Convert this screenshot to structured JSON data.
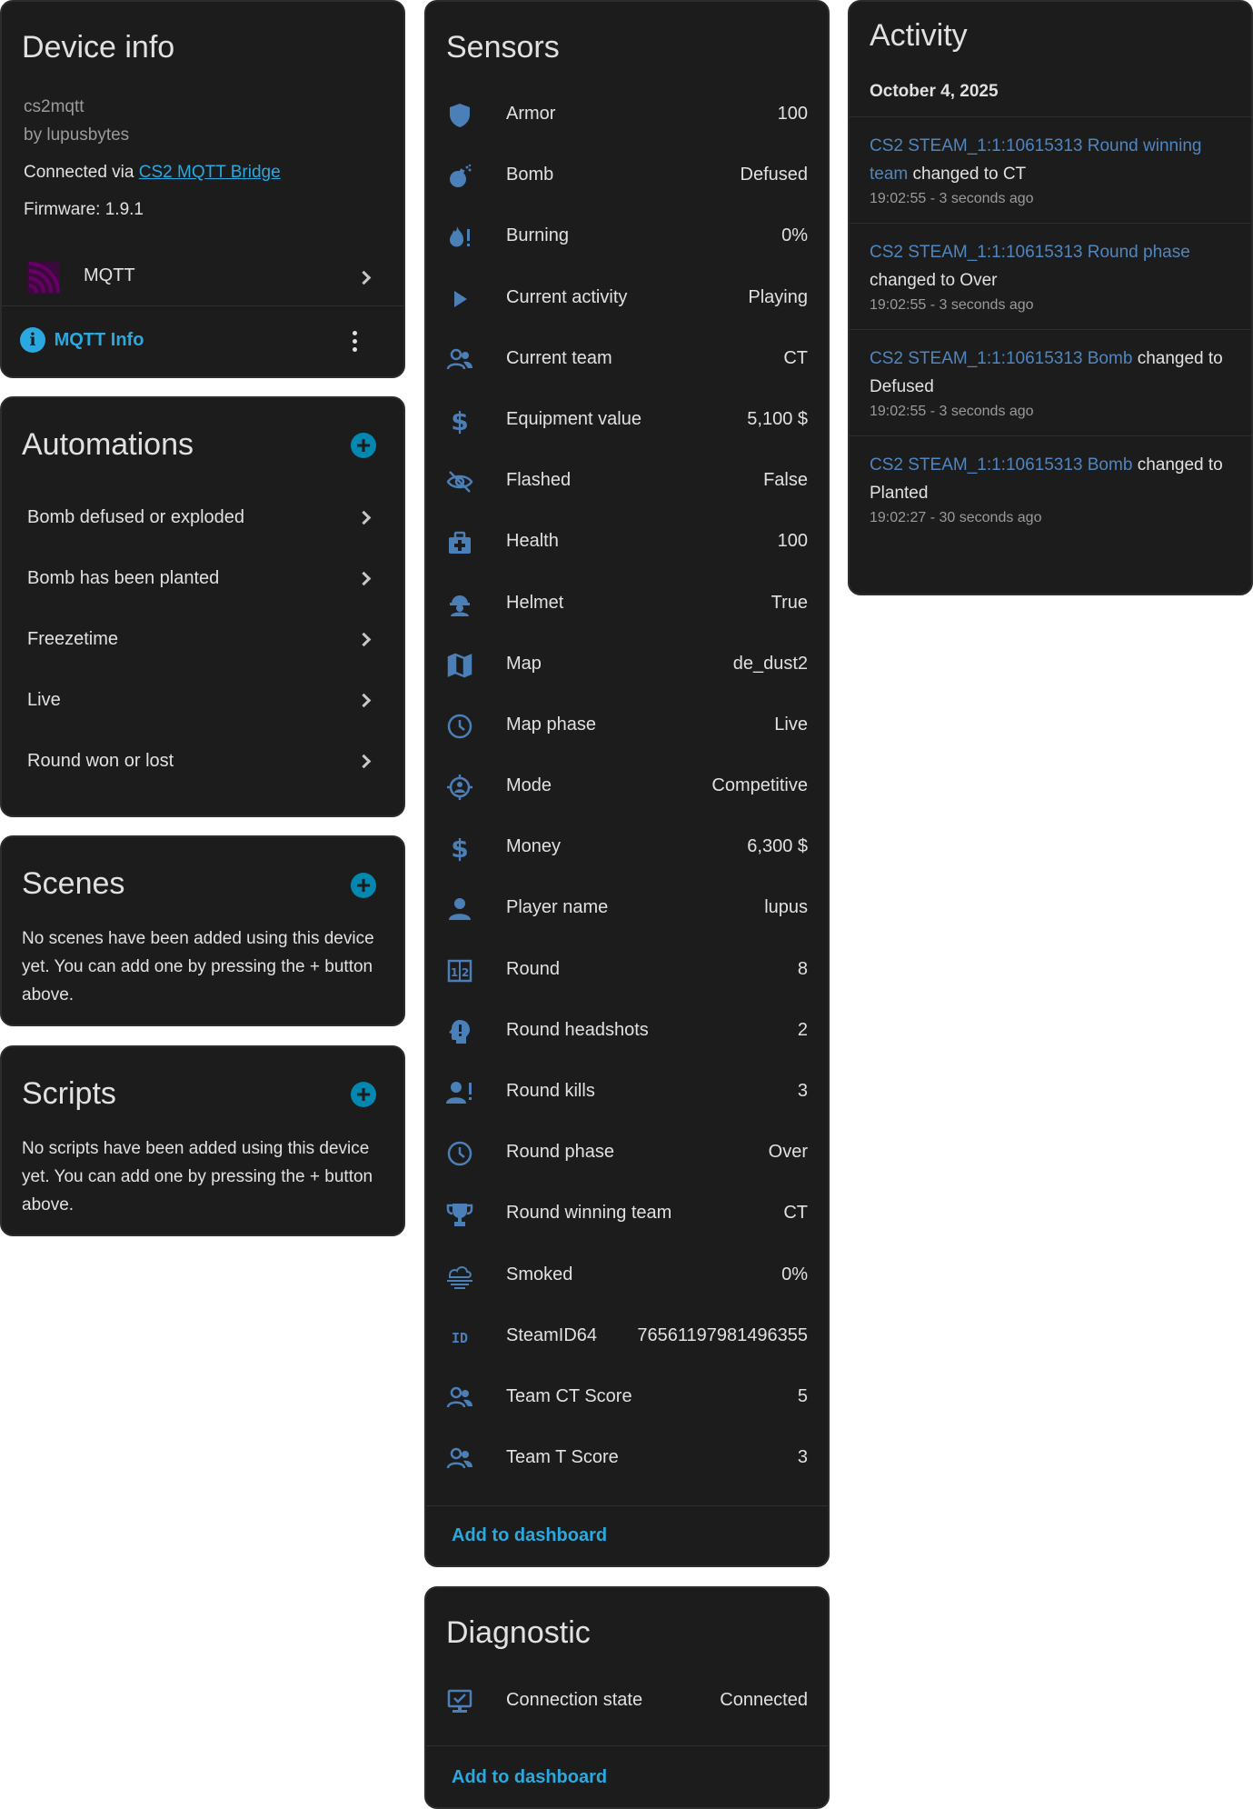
{
  "device_info": {
    "title": "Device info",
    "model": "cs2mqtt",
    "manufacturer": "by lupusbytes",
    "connected_via_prefix": "Connected via",
    "connected_via_link": "CS2 MQTT Bridge",
    "firmware": "Firmware: 1.9.1",
    "integration_label": "MQTT",
    "mqtt_info_label": "MQTT Info"
  },
  "automations": {
    "title": "Automations",
    "items": [
      {
        "label": "Bomb defused or exploded"
      },
      {
        "label": "Bomb has been planted"
      },
      {
        "label": "Freezetime"
      },
      {
        "label": "Live"
      },
      {
        "label": "Round won or lost"
      }
    ]
  },
  "scenes": {
    "title": "Scenes",
    "empty_text": "No scenes have been added using this device yet. You can add one by pressing the + button above."
  },
  "scripts": {
    "title": "Scripts",
    "empty_text": "No scripts have been added using this device yet. You can add one by pressing the + button above."
  },
  "sensors": {
    "title": "Sensors",
    "items": [
      {
        "icon": "shield-icon",
        "name": "Armor",
        "value": "100"
      },
      {
        "icon": "bomb-icon",
        "name": "Bomb",
        "value": "Defused"
      },
      {
        "icon": "fire-alert-icon",
        "name": "Burning",
        "value": "0%"
      },
      {
        "icon": "play-icon",
        "name": "Current activity",
        "value": "Playing"
      },
      {
        "icon": "account-group-icon",
        "name": "Current team",
        "value": "CT"
      },
      {
        "icon": "dollar-icon",
        "name": "Equipment value",
        "value": "5,100 $"
      },
      {
        "icon": "eye-off-icon",
        "name": "Flashed",
        "value": "False"
      },
      {
        "icon": "medical-bag-icon",
        "name": "Health",
        "value": "100"
      },
      {
        "icon": "helmet-icon",
        "name": "Helmet",
        "value": "True"
      },
      {
        "icon": "map-icon",
        "name": "Map",
        "value": "de_dust2"
      },
      {
        "icon": "clock-icon",
        "name": "Map phase",
        "value": "Live"
      },
      {
        "icon": "crosshairs-icon",
        "name": "Mode",
        "value": "Competitive"
      },
      {
        "icon": "dollar-icon",
        "name": "Money",
        "value": "6,300 $"
      },
      {
        "icon": "account-icon",
        "name": "Player name",
        "value": "lupus"
      },
      {
        "icon": "scoreboard-icon",
        "name": "Round",
        "value": "8"
      },
      {
        "icon": "head-alert-icon",
        "name": "Round headshots",
        "value": "2"
      },
      {
        "icon": "account-alert-icon",
        "name": "Round kills",
        "value": "3"
      },
      {
        "icon": "clock-icon",
        "name": "Round phase",
        "value": "Over"
      },
      {
        "icon": "trophy-icon",
        "name": "Round winning team",
        "value": "CT"
      },
      {
        "icon": "smoke-icon",
        "name": "Smoked",
        "value": "0%"
      },
      {
        "icon": "id-icon",
        "name": "SteamID64",
        "value": "76561197981496355"
      },
      {
        "icon": "account-group-icon",
        "name": "Team CT Score",
        "value": "5"
      },
      {
        "icon": "account-group-icon",
        "name": "Team T Score",
        "value": "3"
      }
    ],
    "add_to_dashboard": "Add to dashboard"
  },
  "diagnostic": {
    "title": "Diagnostic",
    "items": [
      {
        "icon": "monitor-check-icon",
        "name": "Connection state",
        "value": "Connected"
      }
    ],
    "add_to_dashboard": "Add to dashboard"
  },
  "activity": {
    "title": "Activity",
    "date": "October 4, 2025",
    "entries": [
      {
        "entity": "CS2 STEAM_1:1:10615313 Round winning team",
        "change": "changed to CT",
        "time": "19:02:55 - 3 seconds ago"
      },
      {
        "entity": "CS2 STEAM_1:1:10615313 Round phase",
        "change": "changed to Over",
        "time": "19:02:55 - 3 seconds ago"
      },
      {
        "entity": "CS2 STEAM_1:1:10615313 Bomb",
        "change": "changed to Defused",
        "time": "19:02:55 - 3 seconds ago"
      },
      {
        "entity": "CS2 STEAM_1:1:10615313 Bomb",
        "change": "changed to Planted",
        "time": "19:02:27 - 30 seconds ago"
      }
    ]
  },
  "colors": {
    "card_bg": "#1c1c1c",
    "icon": "#4a7fb8",
    "link": "#2aa9e0",
    "plus": "#0288b0",
    "mqtt_logo": "#660066"
  }
}
